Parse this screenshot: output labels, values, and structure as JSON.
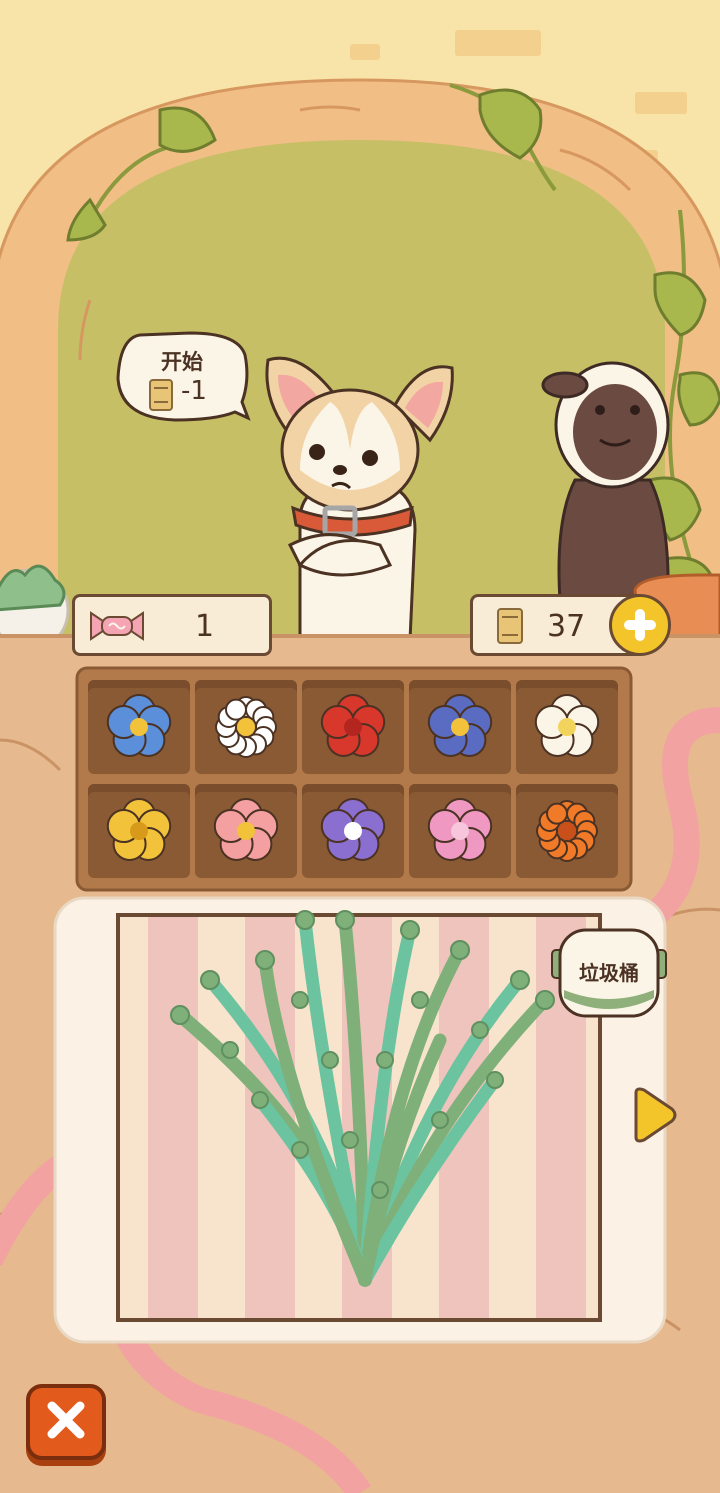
{
  "speech_bubble": {
    "title": "开始",
    "cost": "-1",
    "cost_icon": "scroll-ticket-icon"
  },
  "counters": {
    "candy": {
      "icon": "candy-icon",
      "value": "1"
    },
    "tickets": {
      "icon": "scroll-ticket-icon",
      "value": "37",
      "add_icon": "plus-icon"
    }
  },
  "flowers": [
    {
      "name": "blue-star-flower",
      "color": "#5b8fd9",
      "center": "#f2c23b"
    },
    {
      "name": "white-daisy",
      "color": "#ffffff",
      "center": "#f2c23b"
    },
    {
      "name": "red-rose",
      "color": "#d8372c",
      "center": "#b3261f"
    },
    {
      "name": "purple-pansy",
      "color": "#5a6cc2",
      "center": "#f2c23b"
    },
    {
      "name": "white-calla-lily",
      "color": "#fbf5e8",
      "center": "#f2d35b"
    },
    {
      "name": "yellow-lily",
      "color": "#f2c23b",
      "center": "#d89a1a"
    },
    {
      "name": "pink-blossom",
      "color": "#f4a0a0",
      "center": "#f2c23b"
    },
    {
      "name": "purple-morning-glory",
      "color": "#8a6fd1",
      "center": "#ffffff"
    },
    {
      "name": "pink-hydrangea",
      "color": "#ee98c2",
      "center": "#f7c6dc"
    },
    {
      "name": "orange-gerbera",
      "color": "#f07a28",
      "center": "#c9501a"
    }
  ],
  "trash_button": {
    "label": "垃圾桶"
  },
  "next_icon": "play-arrow-icon",
  "close_icon": "close-icon",
  "colors": {
    "wall": "#f8e4a8",
    "window": "#c6bf66",
    "arch": "#f1be86",
    "counter": "#e7b98f",
    "accent": "#f3c52b",
    "close": "#e35a1d",
    "stripe_pink": "#eec4bd",
    "stripe_cream": "#f8e4cc"
  }
}
